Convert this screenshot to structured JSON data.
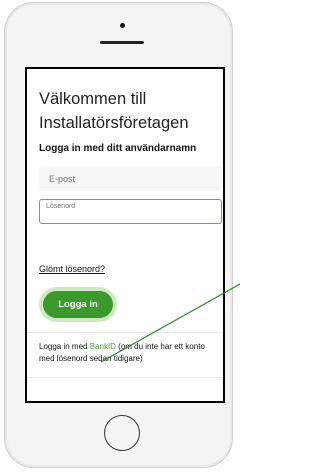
{
  "login": {
    "title_line1": "Välkommen till",
    "title_line2": "Installatörsföretagen",
    "subtitle": "Logga in med ditt användarnamn",
    "email_placeholder": "E-post",
    "password_label": "Lösenord",
    "forgot_link": "Glömt lösenord?",
    "login_button": "Logga in",
    "bankid_prefix": "Logga in med ",
    "bankid_link": "BankID",
    "bankid_suffix": " (om du inte har ett konto med lösenord sedan tidigare)",
    "bottom_text_cut": " "
  },
  "colors": {
    "accent_green": "#3a9a2a",
    "annotation_line": "#2e8b2e"
  }
}
